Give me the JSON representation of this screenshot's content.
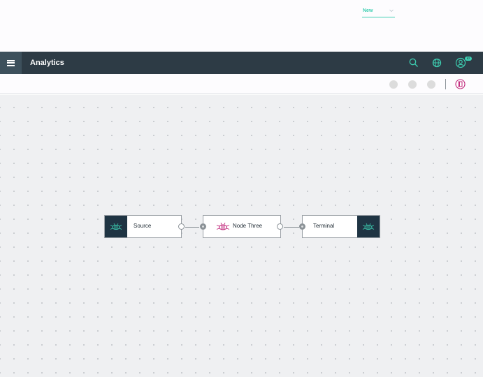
{
  "header": {
    "app_title": "Analytics",
    "dropdown": {
      "selected": "New"
    },
    "icons": [
      "hamburger-menu-icon",
      "search-icon",
      "globe-icon",
      "user-avatar-icon"
    ],
    "notification_badge": "57"
  },
  "toolbar": {
    "icons": [
      "circle-tool",
      "circle-tool",
      "circle-tool",
      "palette-toggle-icon"
    ]
  },
  "flow": {
    "nodes": [
      {
        "label": "Source",
        "icon": "bee-icon"
      },
      {
        "label": "Node Three",
        "icon": "bee-icon"
      },
      {
        "label": "Terminal",
        "icon": "bee-icon"
      }
    ]
  },
  "colors": {
    "header_bg": "#2d3b45",
    "accent": "#3dcfb2",
    "node_icon_bg": "#1f3443",
    "node_three_icon": "#c0257a",
    "canvas_bg": "#eff0f2"
  }
}
